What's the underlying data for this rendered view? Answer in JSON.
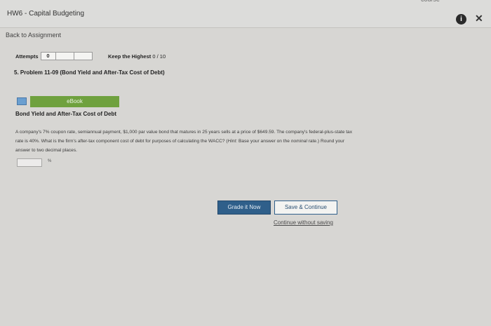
{
  "window": {
    "title": "HW6 - Capital Budgeting",
    "top_edge_text": "course",
    "info_icon": "info-circle-icon",
    "close_icon": "close-icon"
  },
  "nav": {
    "back_link": "Back to Assignment"
  },
  "attempts": {
    "label": "Attempts",
    "value": "0",
    "keep_label": "Keep the Highest",
    "keep_value": "0 / 10"
  },
  "problem": {
    "title": "5. Problem 11-09 (Bond Yield and After-Tax Cost of Debt)",
    "ebook_label": "eBook",
    "heading": "Bond Yield and After-Tax Cost of Debt",
    "q1": "A company's 7% coupon rate, semiannual payment, $1,000 par value bond that matures in 25 years sells at a price of $649.59. The company's federal-plus-state tax",
    "q2_a": "rate is 40%. What is the firm's after-tax component cost of debt for purposes of calculating the WACC? (",
    "q2_hint": "Hint:",
    "q2_b": " Base your answer on the ",
    "q2_nominal": "nominal",
    "q2_c": " rate.) Round your",
    "q3": "answer to two decimal places.",
    "answer_value": "",
    "unit": "%"
  },
  "actions": {
    "grade_label": "Grade it Now",
    "save_label": "Save & Continue",
    "continue_label": "Continue without saving"
  }
}
